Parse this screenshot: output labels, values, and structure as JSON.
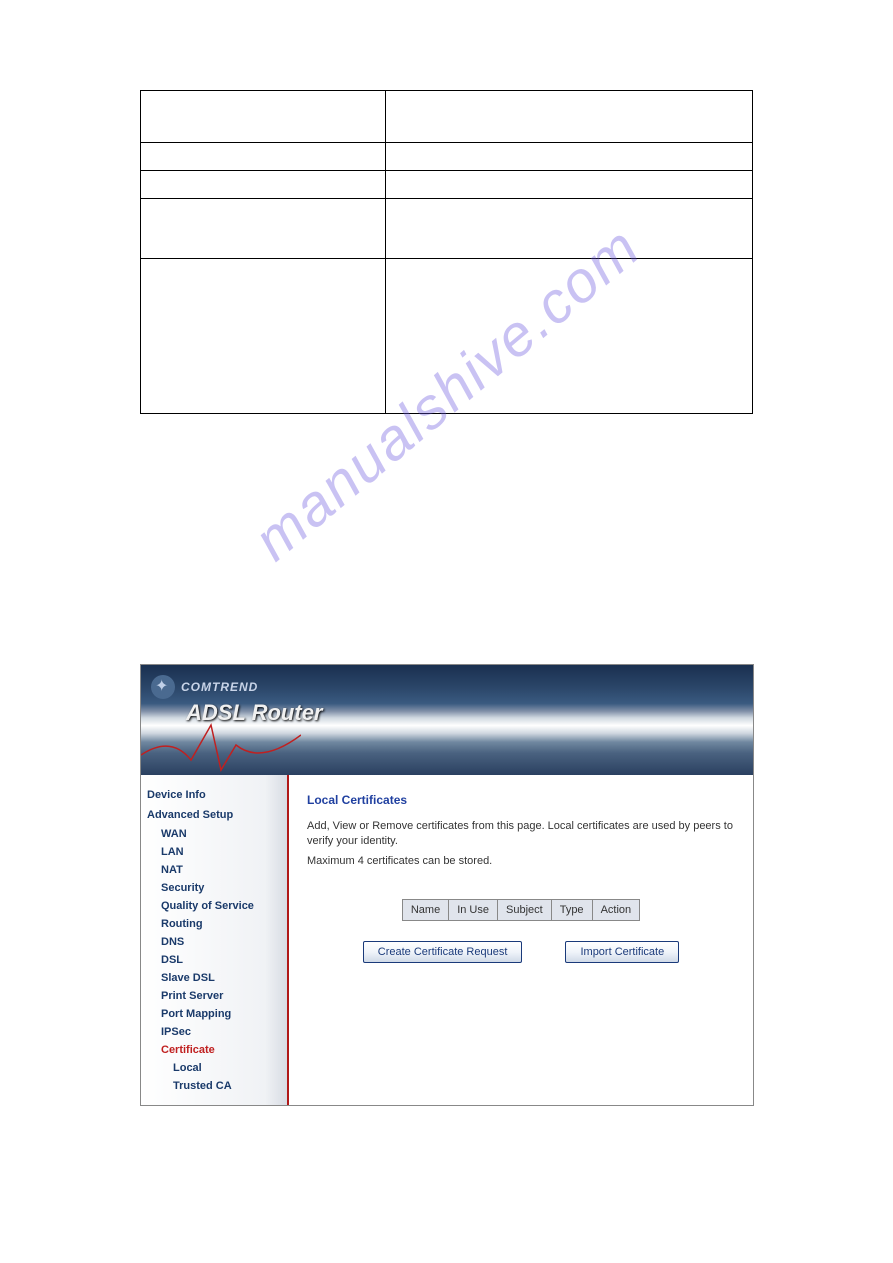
{
  "watermark": "manualshive.com",
  "spec_rows": [
    {
      "left": "",
      "right": ""
    },
    {
      "left": "",
      "right": ""
    },
    {
      "left": "",
      "right": ""
    },
    {
      "left": "",
      "right": ""
    },
    {
      "left": "",
      "right": ""
    }
  ],
  "router": {
    "brand": "COMTREND",
    "title": "ADSL Router",
    "sidebar": {
      "top_heading": "Device Info",
      "main_heading": "Advanced Setup",
      "items": [
        {
          "label": "WAN"
        },
        {
          "label": "LAN"
        },
        {
          "label": "NAT"
        },
        {
          "label": "Security"
        },
        {
          "label": "Quality of Service"
        },
        {
          "label": "Routing"
        },
        {
          "label": "DNS"
        },
        {
          "label": "DSL"
        },
        {
          "label": "Slave DSL"
        },
        {
          "label": "Print Server"
        },
        {
          "label": "Port Mapping"
        },
        {
          "label": "IPSec"
        },
        {
          "label": "Certificate",
          "active": true
        }
      ],
      "subitems": [
        {
          "label": "Local"
        },
        {
          "label": "Trusted CA"
        }
      ]
    },
    "content": {
      "title": "Local Certificates",
      "text1": "Add, View or Remove certificates from this page. Local certificates are used by peers to verify your identity.",
      "text2": "Maximum 4 certificates can be stored.",
      "table_headers": [
        "Name",
        "In Use",
        "Subject",
        "Type",
        "Action"
      ],
      "button1": "Create Certificate Request",
      "button2": "Import Certificate"
    }
  }
}
